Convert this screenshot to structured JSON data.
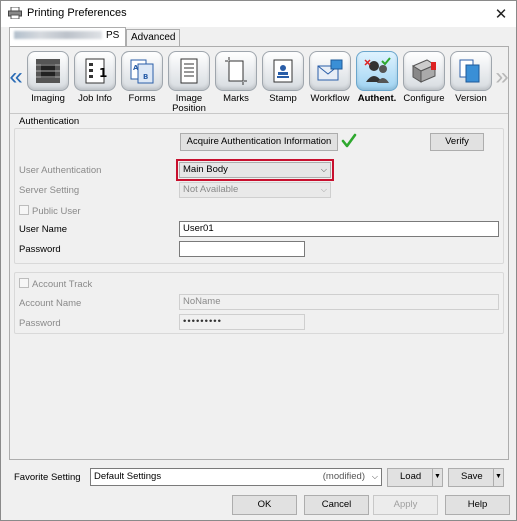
{
  "window": {
    "title": "Printing Preferences",
    "close_glyph": "✕"
  },
  "tabs": [
    {
      "label": "PS",
      "blurred_prefix": true,
      "active": true
    },
    {
      "label": "Advanced",
      "active": false
    }
  ],
  "toolbar": {
    "items": [
      {
        "label": "Imaging",
        "icon": "imaging-icon"
      },
      {
        "label": "Job Info",
        "icon": "job-info-icon"
      },
      {
        "label": "Forms",
        "icon": "forms-icon"
      },
      {
        "label": "Image Position",
        "label_line1": "Image",
        "label_line2": "Position",
        "icon": "image-position-icon"
      },
      {
        "label": "Marks",
        "icon": "marks-icon"
      },
      {
        "label": "Stamp",
        "icon": "stamp-icon"
      },
      {
        "label": "Workflow",
        "icon": "workflow-icon"
      },
      {
        "label": "Authent.",
        "icon": "authentication-icon",
        "active": true
      },
      {
        "label": "Configure",
        "icon": "configure-icon"
      },
      {
        "label": "Version",
        "icon": "version-icon"
      }
    ]
  },
  "authentication": {
    "section_title": "Authentication",
    "acquire_button": "Acquire Authentication Information",
    "verify_button": "Verify",
    "user_auth_label": "User Authentication",
    "user_auth_value": "Main Body",
    "server_setting_label": "Server Setting",
    "server_setting_value": "Not Available",
    "public_user_label": "Public User",
    "user_name_label": "User Name",
    "user_name_value": "User01",
    "password_label": "Password",
    "password_value": ""
  },
  "account_track": {
    "checkbox_label": "Account Track",
    "account_name_label": "Account Name",
    "account_name_value": "NoName",
    "password_label": "Password",
    "password_value": "•••••••••"
  },
  "favorite": {
    "label": "Favorite Setting",
    "value": "Default Settings",
    "modified": "(modified)",
    "load_button": "Load",
    "save_button": "Save"
  },
  "dialog_buttons": {
    "ok": "OK",
    "cancel": "Cancel",
    "apply": "Apply",
    "help": "Help"
  },
  "colors": {
    "highlight": "#c8102e",
    "check": "#2ea82e",
    "nav_arrow": "#2a6bb5"
  }
}
